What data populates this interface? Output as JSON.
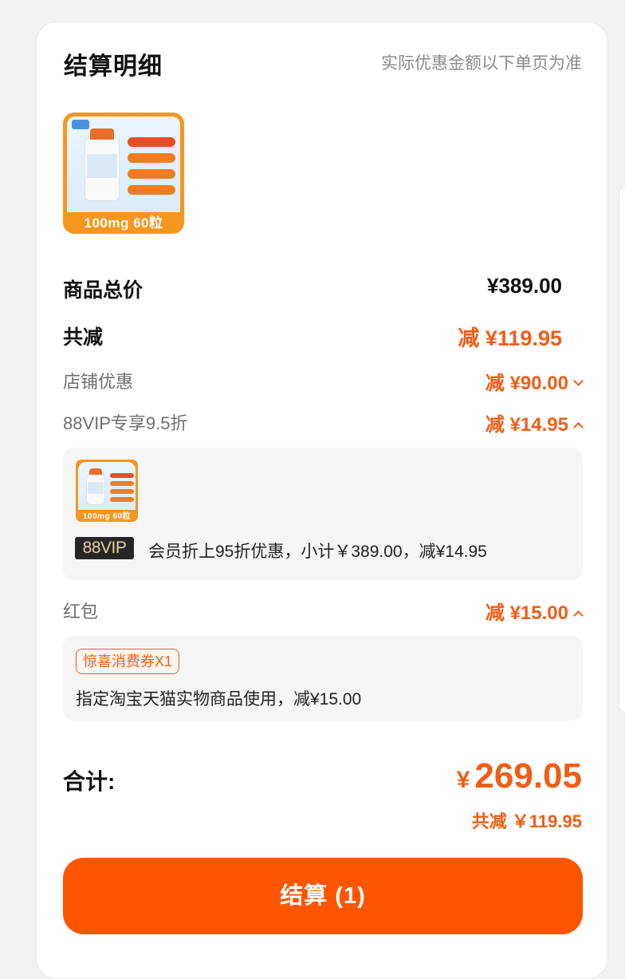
{
  "header": {
    "title": "结算明细",
    "hint": "实际优惠金额以下单页为准"
  },
  "product": {
    "caption": "100mg 60粒"
  },
  "summary": {
    "total_label": "商品总价",
    "total_value": "¥389.00",
    "discount_label": "共减",
    "discount_value": "减 ¥119.95"
  },
  "discounts": [
    {
      "label": "店铺优惠",
      "value": "减 ¥90.00",
      "expanded": false
    },
    {
      "label": "88VIP专享9.5折",
      "value": "减 ¥14.95",
      "expanded": true
    },
    {
      "label": "红包",
      "value": "减 ¥15.00",
      "expanded": true
    }
  ],
  "vip_detail": {
    "badge": "88VIP",
    "text": "会员折上95折优惠，小计￥389.00，减¥14.95",
    "thumb_caption": "100mg 60粒"
  },
  "redpacket_detail": {
    "coupon": "惊喜消费券X1",
    "text": "指定淘宝天猫实物商品使用，减¥15.00"
  },
  "total": {
    "label": "合计:",
    "currency": "¥",
    "amount": "269.05",
    "saved": "共减 ￥119.95"
  },
  "checkout": {
    "label": "结算 (1)"
  },
  "colors": {
    "accent": "#ff5500",
    "accent_text": "#f25d16",
    "vip_badge_bg": "#262626"
  }
}
